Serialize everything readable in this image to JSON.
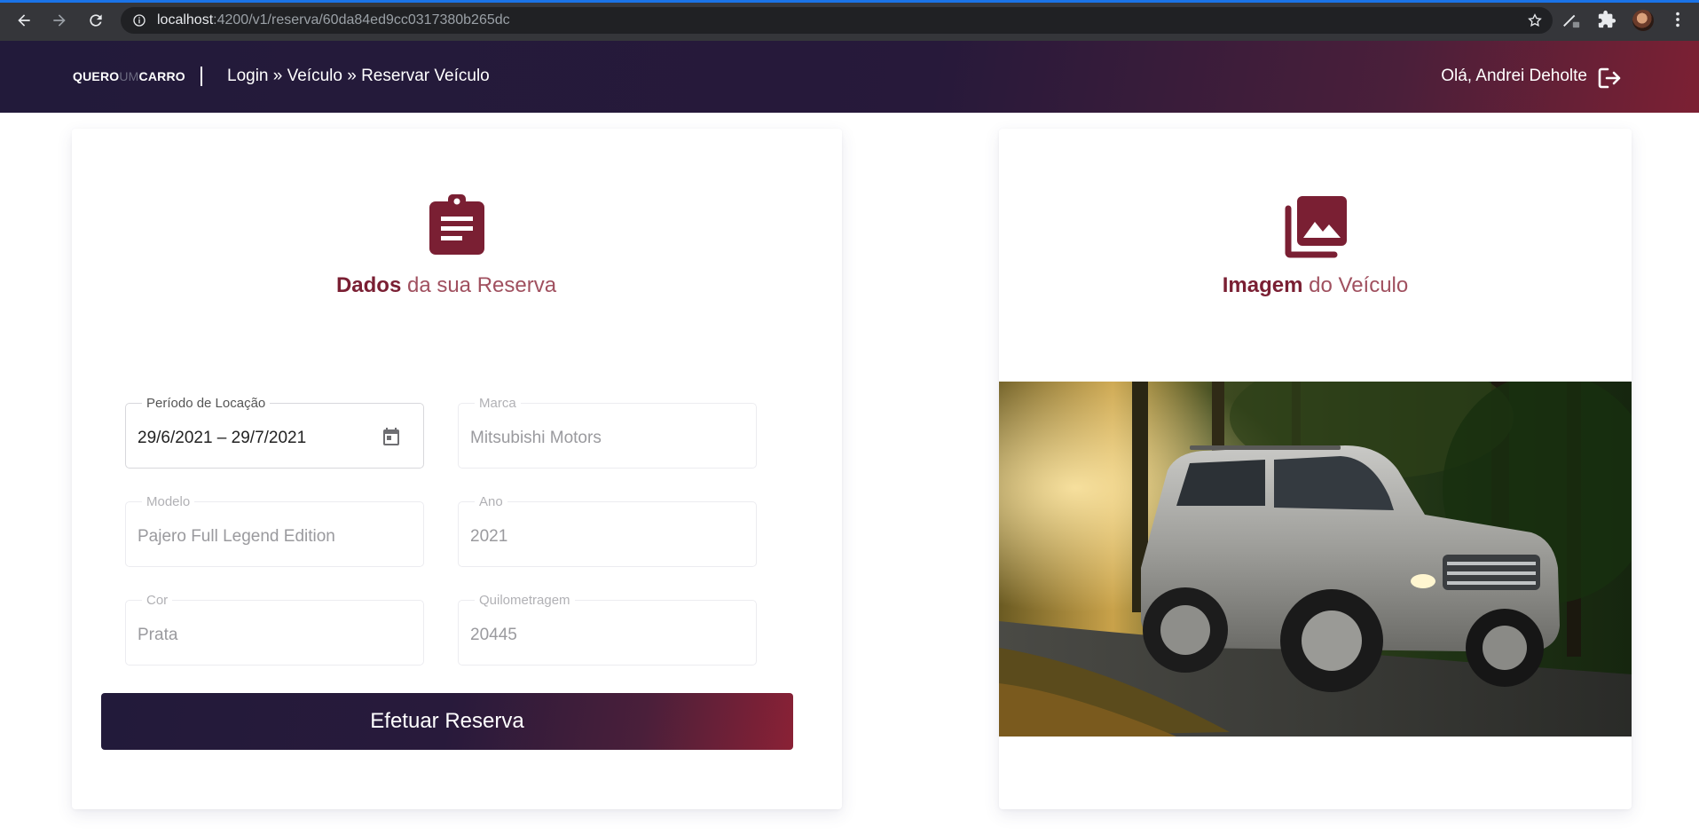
{
  "browser": {
    "url_host": "localhost",
    "url_path": ":4200/v1/reserva/60da84ed9cc0317380b265dc"
  },
  "header": {
    "logo": {
      "part1": "QUERO",
      "part2": "UM",
      "part3": "CARRO"
    },
    "breadcrumb": "Login » Veículo » Reservar Veículo",
    "greeting": "Olá, Andrei Deholte"
  },
  "reservation_card": {
    "title_strong": "Dados",
    "title_light": "da sua Reserva",
    "fields": {
      "period": {
        "label": "Período de Locação",
        "value": "29/6/2021 – 29/7/2021"
      },
      "brand": {
        "label": "Marca",
        "value": "Mitsubishi Motors"
      },
      "model": {
        "label": "Modelo",
        "value": "Pajero Full Legend Edition"
      },
      "year": {
        "label": "Ano",
        "value": "2021"
      },
      "color": {
        "label": "Cor",
        "value": "Prata"
      },
      "mileage": {
        "label": "Quilometragem",
        "value": "20445"
      }
    },
    "submit_label": "Efetuar Reserva"
  },
  "image_card": {
    "title_strong": "Imagem",
    "title_light": "do Veículo"
  },
  "colors": {
    "accent": "#7a1f33",
    "header_dark": "#221a3a",
    "header_red": "#7c2033"
  }
}
